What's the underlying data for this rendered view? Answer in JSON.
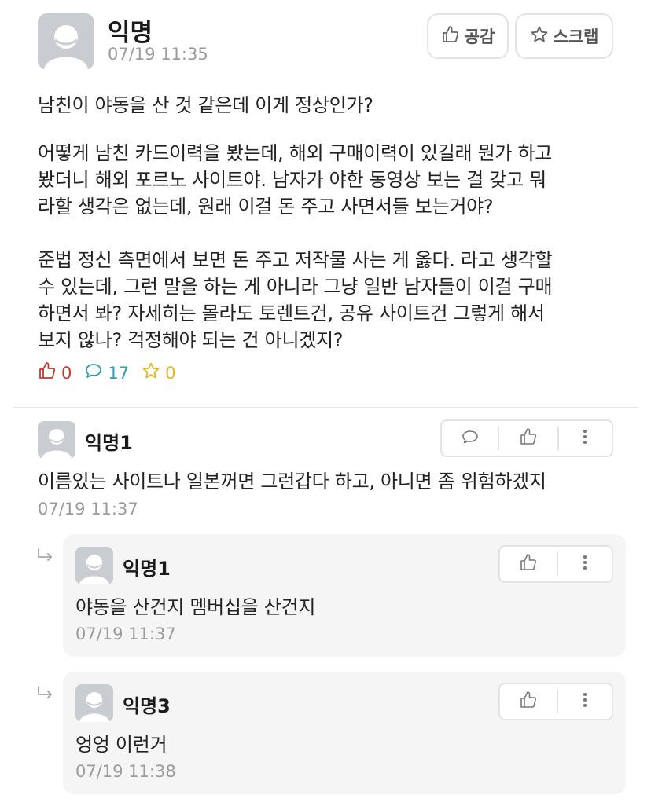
{
  "post": {
    "author": "익명",
    "time": "07/19 11:35",
    "like_button": "공감",
    "scrap_button": "스크랩",
    "title": "남친이 야동을 산 것 같은데 이게 정상인가?",
    "paragraphs": [
      [
        "어떻게 남친 카드이력을 봤는데, 해외 구매이력이 있길래 뭔가 하고",
        "봤더니 해외 포르노 사이트야. 남자가 야한 동영상 보는 걸 갖고 뭐",
        "라할 생각은 없는데, 원래 이걸 돈 주고 사면서들 보는거야?"
      ],
      [
        "준법 정신 측면에서 보면 돈 주고 저작물 사는 게 옳다. 라고 생각할",
        "수 있는데, 그런 말을 하는 게 아니라 그냥 일반 남자들이 이걸 구매",
        "하면서 봐? 자세히는 몰라도 토렌트건, 공유 사이트건 그렇게 해서",
        "보지 않나? 걱정해야 되는 건 아니겠지?"
      ]
    ],
    "stats": {
      "likes": "0",
      "comments": "17",
      "scraps": "0"
    }
  },
  "comments": [
    {
      "author": "익명1",
      "text": "이름있는 사이트나 일본꺼면 그런갑다 하고, 아니면 좀 위험하겠지",
      "time": "07/19 11:37"
    }
  ],
  "replies": [
    {
      "author": "익명1",
      "text": "야동을 산건지 멤버십을 산건지",
      "time": "07/19 11:37"
    },
    {
      "author": "익명3",
      "text": "엉엉 이런거",
      "time": "07/19 11:38"
    }
  ],
  "colors": {
    "like": "#c0392b",
    "comment": "#2aa0b8",
    "scrap": "#e6b422",
    "muted": "#9b9b9b"
  }
}
